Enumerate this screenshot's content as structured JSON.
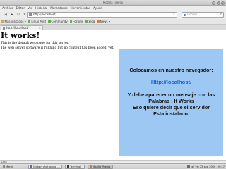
{
  "window": {
    "title": "Mozilla Firefox",
    "controls": [
      "_",
      "□",
      "×"
    ]
  },
  "menu": [
    "Archivo",
    "Editar",
    "Ver",
    "Historial",
    "Marcadores",
    "Herramientas",
    "Ayuda"
  ],
  "navigation": {
    "back": "◀",
    "forward": "▶",
    "reload": "↻",
    "stop": "✕",
    "home": "⌂",
    "url": "http://localhost/",
    "star": "☆",
    "search_placeholder": "Google",
    "search_icon": "⚲"
  },
  "bookmarks": [
    {
      "label": "Más visitados ▾",
      "icon": "bookmark-icon",
      "color": "#d9a24a"
    },
    {
      "label": "Linux Mint",
      "icon": "linux-mint-icon",
      "color": "#6aa84f"
    },
    {
      "label": "Community",
      "icon": "community-icon",
      "color": "#6aa84f"
    },
    {
      "label": "Forums",
      "icon": "forums-icon",
      "color": "#6aa84f"
    },
    {
      "label": "Blog",
      "icon": "blog-icon",
      "color": "#6aa84f"
    },
    {
      "label": "News ▾",
      "icon": "rss-icon",
      "color": "#e07b2a"
    }
  ],
  "tab": {
    "label": "http://localhost/",
    "close": "×"
  },
  "page": {
    "heading": "It works!",
    "para1": "This is the default web page for this server.",
    "para2": "The web server software is running but no content has been added, yet."
  },
  "note": {
    "line1": "Colocamos en nuestro navegador:",
    "url": "Http://localhost/",
    "line3": "Y debe aparecer un mensaje con las",
    "line4": "Palabras : It Works",
    "line5": "Eso quiere decir que el servidor",
    "line6": "Esta instalado.",
    "background": "#9ec8f4",
    "url_color": "#1a5fd6"
  },
  "status": {
    "text": "Listo"
  },
  "taskbar": {
    "tasks": [
      {
        "label": "Menú",
        "icon": "mint-menu-icon",
        "color": "#6aa84f"
      },
      {
        "label": "[pidgin chat group ...",
        "icon": "pidgin-icon",
        "color": "#7b5aa6"
      },
      {
        "label": "Terminal",
        "icon": "terminal-icon",
        "color": "#333333"
      },
      {
        "label": "Mozilla Firefox",
        "icon": "firefox-icon",
        "color": "#e0762a"
      }
    ],
    "volume": "◂)",
    "clock": "vie 25 sep 2009, 09:27"
  }
}
